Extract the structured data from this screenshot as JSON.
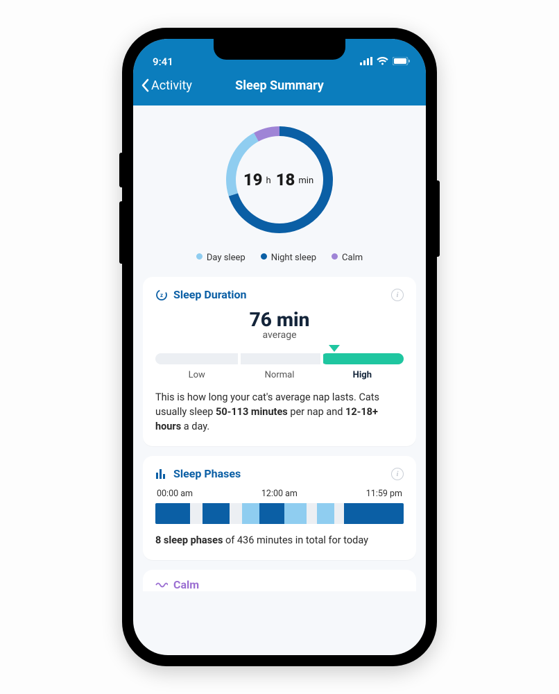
{
  "statusbar": {
    "time": "9:41"
  },
  "nav": {
    "back_label": "Activity",
    "title": "Sleep Summary"
  },
  "ring": {
    "hours": "19",
    "hours_unit": "h",
    "minutes": "18",
    "minutes_unit": "min",
    "segments": {
      "night_pct": 70,
      "day_pct": 22,
      "calm_pct": 8
    }
  },
  "legend": {
    "day": "Day sleep",
    "night": "Night sleep",
    "calm": "Calm"
  },
  "colors": {
    "night": "#0b5fa5",
    "day": "#8fcdf0",
    "calm": "#9f84d6",
    "accent": "#1fc6a0",
    "header": "#0b7dbd",
    "track": "#eceff3"
  },
  "duration_card": {
    "title": "Sleep Duration",
    "value": "76 min",
    "sub": "average",
    "labels": {
      "low": "Low",
      "normal": "Normal",
      "high": "High"
    },
    "active": "high",
    "marker_pct": 72,
    "fill_start_pct": 66.7,
    "desc_pre": "This is how long your cat's average nap lasts. Cats usually sleep ",
    "desc_bold1": "50-113 minutes",
    "desc_mid": " per nap and ",
    "desc_bold2": "12-18+ hours",
    "desc_post": " a day."
  },
  "phases_card": {
    "title": "Sleep Phases",
    "t_start": "00:00 am",
    "t_mid": "12:00 am",
    "t_end": "11:59 pm",
    "segments": [
      {
        "w": 14,
        "c": "night"
      },
      {
        "w": 5,
        "c": "gap"
      },
      {
        "w": 11,
        "c": "night"
      },
      {
        "w": 5,
        "c": "gap"
      },
      {
        "w": 7,
        "c": "day"
      },
      {
        "w": 10,
        "c": "night"
      },
      {
        "w": 9,
        "c": "day"
      },
      {
        "w": 4,
        "c": "gap"
      },
      {
        "w": 7,
        "c": "day"
      },
      {
        "w": 4,
        "c": "gap"
      },
      {
        "w": 24,
        "c": "night"
      }
    ],
    "summary_bold": "8 sleep phases",
    "summary_rest": " of 436 minutes in total for today"
  },
  "calm_card": {
    "title": "Calm"
  },
  "chart_data": [
    {
      "type": "pie",
      "title": "Total sleep 19 h 18 min",
      "series": [
        {
          "name": "Night sleep",
          "value": 70,
          "color": "#0b5fa5"
        },
        {
          "name": "Day sleep",
          "value": 22,
          "color": "#8fcdf0"
        },
        {
          "name": "Calm",
          "value": 8,
          "color": "#9f84d6"
        }
      ]
    },
    {
      "type": "bar",
      "title": "Sleep Duration average",
      "categories": [
        "Low",
        "Normal",
        "High"
      ],
      "value_label": "76 min",
      "marker_position_pct": 72,
      "active_category": "High"
    },
    {
      "type": "bar",
      "title": "Sleep Phases timeline",
      "xlabel_start": "00:00 am",
      "xlabel_mid": "12:00 am",
      "xlabel_end": "11:59 pm",
      "segments_pct": [
        {
          "width": 14,
          "kind": "night"
        },
        {
          "width": 5,
          "kind": "gap"
        },
        {
          "width": 11,
          "kind": "night"
        },
        {
          "width": 5,
          "kind": "gap"
        },
        {
          "width": 7,
          "kind": "day"
        },
        {
          "width": 10,
          "kind": "night"
        },
        {
          "width": 9,
          "kind": "day"
        },
        {
          "width": 4,
          "kind": "gap"
        },
        {
          "width": 7,
          "kind": "day"
        },
        {
          "width": 4,
          "kind": "gap"
        },
        {
          "width": 24,
          "kind": "night"
        }
      ],
      "summary": "8 sleep phases of 436 minutes in total for today"
    }
  ]
}
